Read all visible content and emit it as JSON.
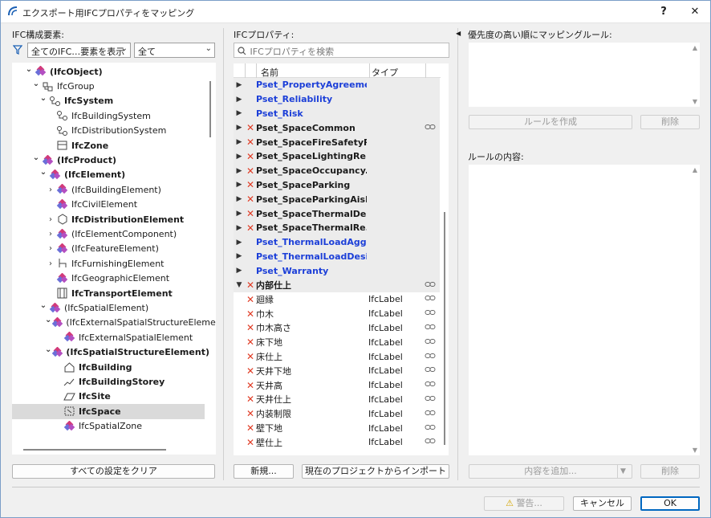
{
  "window": {
    "title": "エクスポート用IFCプロパティをマッピング",
    "help": "?",
    "close": "✕"
  },
  "left": {
    "label": "IFC構成要素:",
    "filter1": "全てのIFC…要素を表示",
    "filter2": "全て",
    "clear_button": "すべての設定をクリア",
    "tree": [
      {
        "label": "(IfcObject)",
        "bold": true,
        "indent": 0,
        "tw": "down",
        "icon": "ifc-entity-icon",
        "selected": false
      },
      {
        "label": "IfcGroup",
        "bold": false,
        "indent": 1,
        "tw": "down",
        "icon": "group-icon",
        "selected": false
      },
      {
        "label": "IfcSystem",
        "bold": true,
        "indent": 2,
        "tw": "down",
        "icon": "system-icon",
        "selected": false
      },
      {
        "label": "IfcBuildingSystem",
        "bold": false,
        "indent": 3,
        "tw": "",
        "icon": "system-icon",
        "selected": false
      },
      {
        "label": "IfcDistributionSystem",
        "bold": false,
        "indent": 3,
        "tw": "",
        "icon": "system-icon",
        "selected": false
      },
      {
        "label": "IfcZone",
        "bold": true,
        "indent": 3,
        "tw": "",
        "icon": "zone-icon",
        "selected": false
      },
      {
        "label": "(IfcProduct)",
        "bold": true,
        "indent": 1,
        "tw": "down",
        "icon": "ifc-entity-icon",
        "selected": false
      },
      {
        "label": "(IfcElement)",
        "bold": true,
        "indent": 2,
        "tw": "down",
        "icon": "ifc-entity-icon",
        "selected": false
      },
      {
        "label": "(IfcBuildingElement)",
        "bold": false,
        "indent": 3,
        "tw": "right",
        "icon": "ifc-entity-icon",
        "selected": false
      },
      {
        "label": "IfcCivilElement",
        "bold": false,
        "indent": 3,
        "tw": "",
        "icon": "ifc-entity-icon",
        "selected": false
      },
      {
        "label": "IfcDistributionElement",
        "bold": true,
        "indent": 3,
        "tw": "right",
        "icon": "distribution-icon",
        "selected": false
      },
      {
        "label": "(IfcElementComponent)",
        "bold": false,
        "indent": 3,
        "tw": "right",
        "icon": "ifc-entity-icon",
        "selected": false
      },
      {
        "label": "(IfcFeatureElement)",
        "bold": false,
        "indent": 3,
        "tw": "right",
        "icon": "ifc-entity-icon",
        "selected": false
      },
      {
        "label": "IfcFurnishingElement",
        "bold": false,
        "indent": 3,
        "tw": "right",
        "icon": "furnishing-icon",
        "selected": false
      },
      {
        "label": "IfcGeographicElement",
        "bold": false,
        "indent": 3,
        "tw": "",
        "icon": "ifc-entity-icon",
        "selected": false
      },
      {
        "label": "IfcTransportElement",
        "bold": true,
        "indent": 3,
        "tw": "",
        "icon": "transport-icon",
        "selected": false
      },
      {
        "label": "(IfcSpatialElement)",
        "bold": false,
        "indent": 2,
        "tw": "down",
        "icon": "ifc-entity-icon",
        "selected": false
      },
      {
        "label": "(IfcExternalSpatialStructureEleme",
        "bold": false,
        "indent": 3,
        "tw": "down",
        "icon": "ifc-entity-icon",
        "selected": false
      },
      {
        "label": "IfcExternalSpatialElement",
        "bold": false,
        "indent": 4,
        "tw": "",
        "icon": "ifc-entity-icon",
        "selected": false
      },
      {
        "label": "(IfcSpatialStructureElement)",
        "bold": true,
        "indent": 3,
        "tw": "down",
        "icon": "ifc-entity-icon",
        "selected": false
      },
      {
        "label": "IfcBuilding",
        "bold": true,
        "indent": 4,
        "tw": "",
        "icon": "building-icon",
        "selected": false
      },
      {
        "label": "IfcBuildingStorey",
        "bold": true,
        "indent": 4,
        "tw": "",
        "icon": "storey-icon",
        "selected": false
      },
      {
        "label": "IfcSite",
        "bold": true,
        "indent": 4,
        "tw": "",
        "icon": "site-icon",
        "selected": false
      },
      {
        "label": "IfcSpace",
        "bold": true,
        "indent": 4,
        "tw": "",
        "icon": "space-icon",
        "selected": true
      },
      {
        "label": "IfcSpatialZone",
        "bold": false,
        "indent": 4,
        "tw": "",
        "icon": "ifc-entity-icon",
        "selected": false
      }
    ]
  },
  "middle": {
    "label": "IFCプロパティ:",
    "search_placeholder": "IFCプロパティを検索",
    "col_name": "名前",
    "col_type": "タイプ",
    "new_button": "新規...",
    "import_button": "現在のプロジェクトからインポート",
    "rows": [
      {
        "name": "Pset_PropertyAgreement",
        "type": "",
        "exp": "right",
        "x": false,
        "blue": true,
        "bold": true,
        "link": false,
        "grey": true
      },
      {
        "name": "Pset_Reliability",
        "type": "",
        "exp": "right",
        "x": false,
        "blue": true,
        "bold": true,
        "link": false,
        "grey": true
      },
      {
        "name": "Pset_Risk",
        "type": "",
        "exp": "right",
        "x": false,
        "blue": true,
        "bold": true,
        "link": false,
        "grey": true
      },
      {
        "name": "Pset_SpaceCommon",
        "type": "",
        "exp": "right",
        "x": true,
        "blue": false,
        "bold": true,
        "link": true,
        "grey": true
      },
      {
        "name": "Pset_SpaceFireSafetyR...",
        "type": "",
        "exp": "right",
        "x": true,
        "blue": false,
        "bold": true,
        "link": false,
        "grey": true
      },
      {
        "name": "Pset_SpaceLightingRe...",
        "type": "",
        "exp": "right",
        "x": true,
        "blue": false,
        "bold": true,
        "link": false,
        "grey": true
      },
      {
        "name": "Pset_SpaceOccupancy...",
        "type": "",
        "exp": "right",
        "x": true,
        "blue": false,
        "bold": true,
        "link": false,
        "grey": true
      },
      {
        "name": "Pset_SpaceParking",
        "type": "",
        "exp": "right",
        "x": true,
        "blue": false,
        "bold": true,
        "link": false,
        "grey": true
      },
      {
        "name": "Pset_SpaceParkingAisle",
        "type": "",
        "exp": "right",
        "x": true,
        "blue": false,
        "bold": true,
        "link": false,
        "grey": true
      },
      {
        "name": "Pset_SpaceThermalDe...",
        "type": "",
        "exp": "right",
        "x": true,
        "blue": false,
        "bold": true,
        "link": false,
        "grey": true
      },
      {
        "name": "Pset_SpaceThermalRe...",
        "type": "",
        "exp": "right",
        "x": true,
        "blue": false,
        "bold": true,
        "link": false,
        "grey": true
      },
      {
        "name": "Pset_ThermalLoadAgg...",
        "type": "",
        "exp": "right",
        "x": false,
        "blue": true,
        "bold": true,
        "link": false,
        "grey": true
      },
      {
        "name": "Pset_ThermalLoadDesi...",
        "type": "",
        "exp": "right",
        "x": false,
        "blue": true,
        "bold": true,
        "link": false,
        "grey": true
      },
      {
        "name": "Pset_Warranty",
        "type": "",
        "exp": "right",
        "x": false,
        "blue": true,
        "bold": true,
        "link": false,
        "grey": true
      },
      {
        "name": "内部仕上",
        "type": "",
        "exp": "down",
        "x": true,
        "blue": false,
        "bold": true,
        "link": true,
        "grey": true
      },
      {
        "name": "廻縁",
        "type": "IfcLabel",
        "exp": "",
        "x": true,
        "blue": false,
        "bold": false,
        "link": true,
        "grey": false
      },
      {
        "name": "巾木",
        "type": "IfcLabel",
        "exp": "",
        "x": true,
        "blue": false,
        "bold": false,
        "link": true,
        "grey": false
      },
      {
        "name": "巾木高さ",
        "type": "IfcLabel",
        "exp": "",
        "x": true,
        "blue": false,
        "bold": false,
        "link": true,
        "grey": false
      },
      {
        "name": "床下地",
        "type": "IfcLabel",
        "exp": "",
        "x": true,
        "blue": false,
        "bold": false,
        "link": true,
        "grey": false
      },
      {
        "name": "床仕上",
        "type": "IfcLabel",
        "exp": "",
        "x": true,
        "blue": false,
        "bold": false,
        "link": true,
        "grey": false
      },
      {
        "name": "天井下地",
        "type": "IfcLabel",
        "exp": "",
        "x": true,
        "blue": false,
        "bold": false,
        "link": true,
        "grey": false
      },
      {
        "name": "天井高",
        "type": "IfcLabel",
        "exp": "",
        "x": true,
        "blue": false,
        "bold": false,
        "link": true,
        "grey": false
      },
      {
        "name": "天井仕上",
        "type": "IfcLabel",
        "exp": "",
        "x": true,
        "blue": false,
        "bold": false,
        "link": true,
        "grey": false
      },
      {
        "name": "内装制限",
        "type": "IfcLabel",
        "exp": "",
        "x": true,
        "blue": false,
        "bold": false,
        "link": true,
        "grey": false
      },
      {
        "name": "壁下地",
        "type": "IfcLabel",
        "exp": "",
        "x": true,
        "blue": false,
        "bold": false,
        "link": true,
        "grey": false
      },
      {
        "name": "壁仕上",
        "type": "IfcLabel",
        "exp": "",
        "x": true,
        "blue": false,
        "bold": false,
        "link": true,
        "grey": false
      }
    ]
  },
  "right": {
    "rules_label": "優先度の高い順にマッピングルール:",
    "create_rule": "ルールを作成",
    "delete1": "削除",
    "content_label": "ルールの内容:",
    "add_content": "内容を追加...",
    "delete2": "削除"
  },
  "footer": {
    "warning": "警告...",
    "cancel": "キャンセル",
    "ok": "OK"
  },
  "colors": {
    "accent": "#0067c0",
    "error": "#e03b24",
    "link_blue": "#1c3fd8"
  }
}
